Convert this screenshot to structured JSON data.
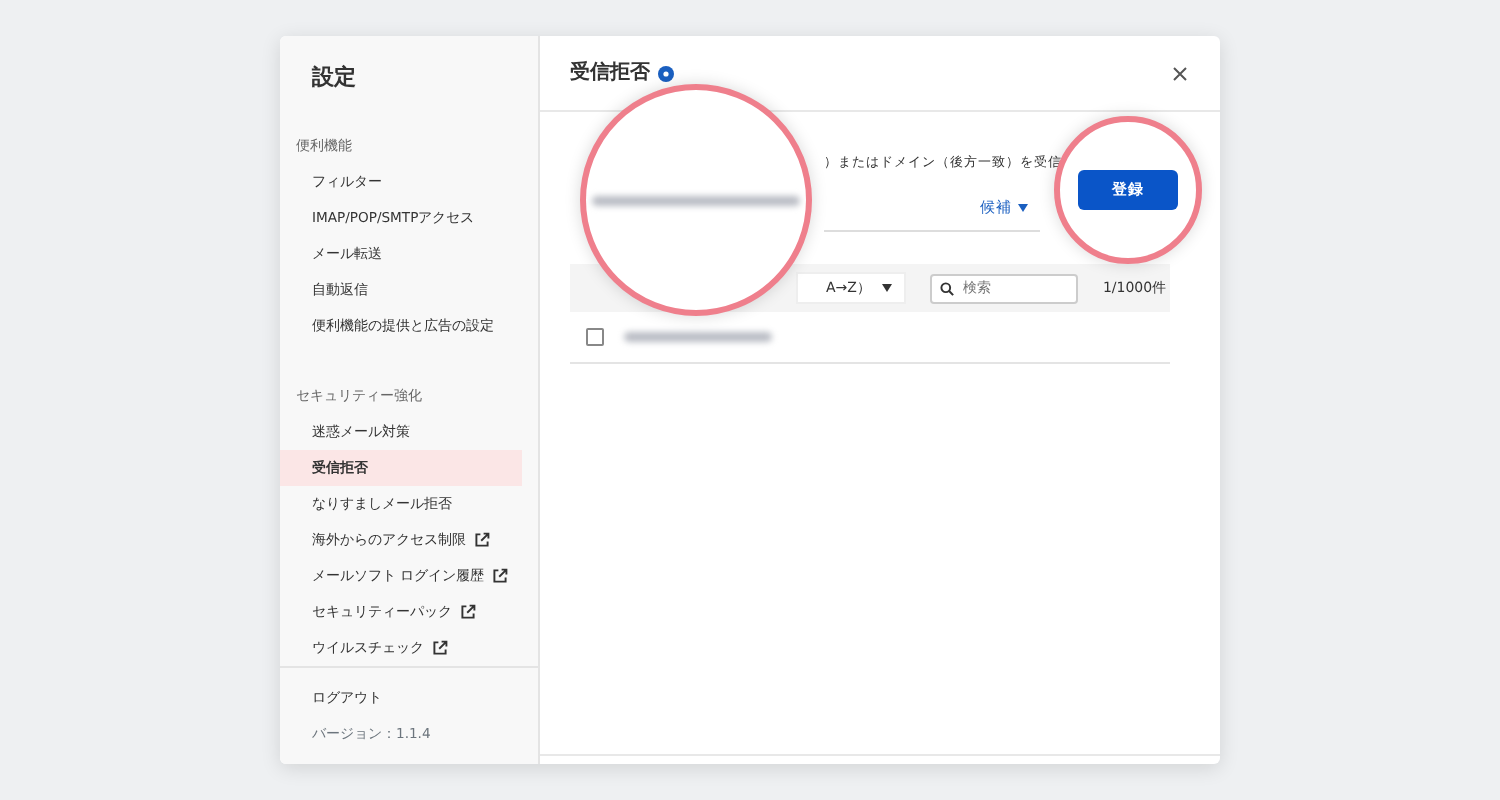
{
  "window": {
    "title": "設定"
  },
  "sidebar": {
    "sections": [
      {
        "heading": "便利機能",
        "items": [
          {
            "label": "フィルター",
            "selected": false,
            "external": false
          },
          {
            "label": "IMAP/POP/SMTPアクセス",
            "selected": false,
            "external": false
          },
          {
            "label": "メール転送",
            "selected": false,
            "external": false
          },
          {
            "label": "自動返信",
            "selected": false,
            "external": false
          },
          {
            "label": "便利機能の提供と広告の設定",
            "selected": false,
            "external": false
          }
        ]
      },
      {
        "heading": "セキュリティー強化",
        "items": [
          {
            "label": "迷惑メール対策",
            "selected": false,
            "external": false
          },
          {
            "label": "受信拒否",
            "selected": true,
            "external": false
          },
          {
            "label": "なりすましメール拒否",
            "selected": false,
            "external": false
          },
          {
            "label": "海外からのアクセス制限",
            "selected": false,
            "external": true
          },
          {
            "label": "メールソフト ログイン履歴",
            "selected": false,
            "external": true
          },
          {
            "label": "セキュリティーパック",
            "selected": false,
            "external": true
          },
          {
            "label": "ウイルスチェック",
            "selected": false,
            "external": true
          }
        ]
      }
    ],
    "logout": "ログアウト",
    "version": "バージョン：1.1.4"
  },
  "panel": {
    "title": "受信拒否",
    "description": "）またはドメイン（後方一致）を受信",
    "suggest_link": "候補",
    "register_button": "登録",
    "sort_label": "A→Z）",
    "search_placeholder": "検索",
    "count": "1/1000件",
    "rows": [
      {
        "checked": false
      }
    ]
  }
}
